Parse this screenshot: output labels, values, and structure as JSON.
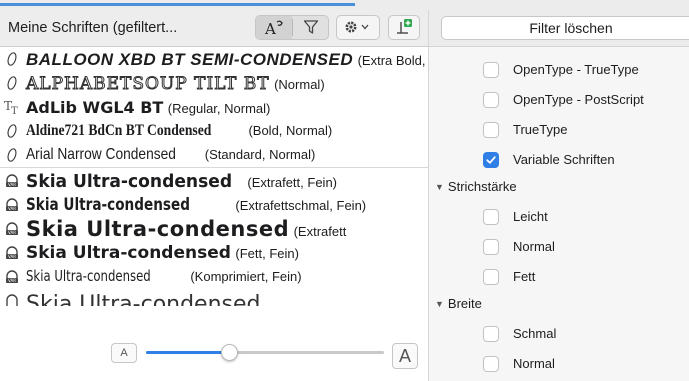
{
  "toolbar": {
    "title": "Meine Schriften (gefiltert..."
  },
  "fonts": [
    {
      "name": "BALLOON XBD BT SEMI-CONDENSED",
      "style": "(Extra Bold, N",
      "icon": "opentype-icon"
    },
    {
      "name": "ALPHABETSOUP TILT BT",
      "style": "(Normal)",
      "icon": "opentype-icon"
    },
    {
      "name": "AdLib WGL4 BT",
      "style": "(Regular, Normal)",
      "icon": "truetype-icon"
    },
    {
      "name": "Aldine721 BdCn BT Condensed",
      "style": "(Bold, Normal)",
      "icon": "opentype-icon"
    },
    {
      "name": "Arial Narrow Condensed",
      "style": "(Standard, Normal)",
      "icon": "opentype-icon"
    },
    {
      "name": "Skia Ultra-condensed",
      "style": "(Extrafett, Fein)",
      "icon": "variable-font-icon"
    },
    {
      "name": "Skia Ultra-condensed",
      "style": "(Extrafettschmal, Fein)",
      "icon": "variable-font-icon"
    },
    {
      "name": "Skia Ultra-condensed",
      "style": "(Extrafett",
      "icon": "variable-font-icon"
    },
    {
      "name": "Skia Ultra-condensed",
      "style": "(Fett, Fein)",
      "icon": "variable-font-icon"
    },
    {
      "name": "Skia Ultra-condensed",
      "style": "(Komprimiert, Fein)",
      "icon": "variable-font-icon"
    },
    {
      "name": "Skia Ultra-condensed",
      "style": "",
      "icon": "variable-font-icon"
    }
  ],
  "sizebar": {
    "small_label": "A",
    "large_label": "A",
    "slider_fraction": 0.35
  },
  "filter": {
    "clear_label": "Filter löschen",
    "format_items": [
      {
        "label": "OpenType - TrueType",
        "checked": false
      },
      {
        "label": "OpenType - PostScript",
        "checked": false
      },
      {
        "label": "TrueType",
        "checked": false
      },
      {
        "label": "Variable Schriften",
        "checked": true
      }
    ],
    "weight_heading": "Strichstärke",
    "weight_items": [
      {
        "label": "Leicht",
        "checked": false
      },
      {
        "label": "Normal",
        "checked": false
      },
      {
        "label": "Fett",
        "checked": false
      }
    ],
    "width_heading": "Breite",
    "width_items": [
      {
        "label": "Schmal",
        "checked": false
      },
      {
        "label": "Normal",
        "checked": false
      }
    ]
  },
  "colors": {
    "accent": "#2f7fe6",
    "toolbar_bg": "#ededed",
    "sidebar_bg": "#f6f6f6"
  }
}
